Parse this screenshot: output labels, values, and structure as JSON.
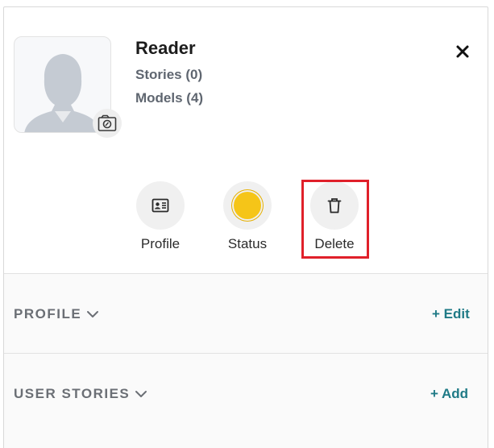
{
  "user": {
    "name": "Reader",
    "stories": "Stories (0)",
    "models": "Models (4)"
  },
  "icons": {
    "avatar": "person-silhouette-icon",
    "camera": "camera-icon",
    "close": "close-icon",
    "profile": "id-card-icon",
    "status": "status-dot-icon",
    "delete": "trash-icon",
    "chevron": "chevron-down-icon"
  },
  "actions": {
    "profile_label": "Profile",
    "status_label": "Status",
    "delete_label": "Delete"
  },
  "colors": {
    "status": "#f5c518",
    "highlight": "#e0202a",
    "link": "#1f7a86"
  },
  "sections": {
    "profile": {
      "title": "PROFILE",
      "action": "+ Edit"
    },
    "user_stories": {
      "title": "USER STORIES",
      "action": "+ Add"
    }
  }
}
